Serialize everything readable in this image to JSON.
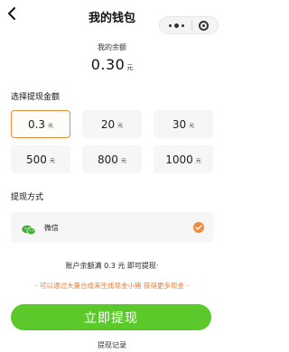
{
  "header": {
    "title": "我的钱包"
  },
  "balance": {
    "label": "我的余额",
    "value": "0.30",
    "unit": "元"
  },
  "amount_section": {
    "title": "选择提现金额",
    "options": [
      {
        "value": "0.3",
        "unit": "元",
        "selected": true
      },
      {
        "value": "20",
        "unit": "元",
        "selected": false
      },
      {
        "value": "30",
        "unit": "元",
        "selected": false
      },
      {
        "value": "500",
        "unit": "元",
        "selected": false
      },
      {
        "value": "800",
        "unit": "元",
        "selected": false
      },
      {
        "value": "1000",
        "unit": "元",
        "selected": false
      }
    ]
  },
  "method_section": {
    "title": "提现方式",
    "method": {
      "label": "微信",
      "icon": "wechat-icon",
      "selected": true
    }
  },
  "tips": {
    "line1": "账户余额满 0.3 元 即可提现·",
    "line2": "- 可以通过大量合成来生成现金小猪 获得更多现金 -"
  },
  "actions": {
    "withdraw_label": "立即提现",
    "record_label": "提现记录"
  },
  "colors": {
    "accent": "#5cc92b",
    "selected_border": "#ee8a3a",
    "tip_orange": "#f07a2a",
    "check": "#f08a3c"
  }
}
